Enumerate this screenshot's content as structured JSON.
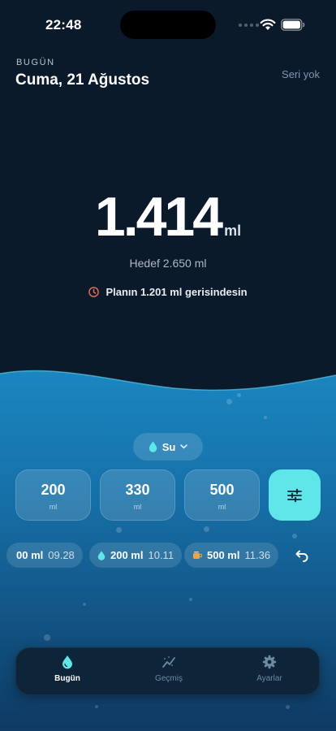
{
  "status_bar": {
    "time": "22:48"
  },
  "header": {
    "label": "BUGÜN",
    "date": "Cuma, 21 Ağustos",
    "streak": "Seri yok"
  },
  "intake": {
    "amount": "1.414",
    "unit": "ml",
    "goal": "Hedef 2.650 ml",
    "behind": "Planın 1.201 ml gerisindesin"
  },
  "drink": {
    "label": "Su",
    "icon": "water-drop-icon"
  },
  "quick_add": [
    {
      "value": "200",
      "unit": "ml"
    },
    {
      "value": "330",
      "unit": "ml"
    },
    {
      "value": "500",
      "unit": "ml"
    }
  ],
  "custom_button_icon": "sliders-icon",
  "history": [
    {
      "amount": "00 ml",
      "time": "09.28",
      "icon": "none"
    },
    {
      "amount": "200 ml",
      "time": "10.11",
      "icon": "water-drop-icon"
    },
    {
      "amount": "500 ml",
      "time": "11.36",
      "icon": "coffee-icon"
    }
  ],
  "tabs": [
    {
      "label": "Bugün",
      "icon": "water-drop-icon",
      "active": true
    },
    {
      "label": "Geçmiş",
      "icon": "chart-icon",
      "active": false
    },
    {
      "label": "Ayarlar",
      "icon": "gear-icon",
      "active": false
    }
  ],
  "colors": {
    "accent": "#5ee6e8",
    "background": "#0b1a2b",
    "water_top": "#1a86c0",
    "water_bottom": "#0e3a63",
    "warning": "#e8705a"
  }
}
